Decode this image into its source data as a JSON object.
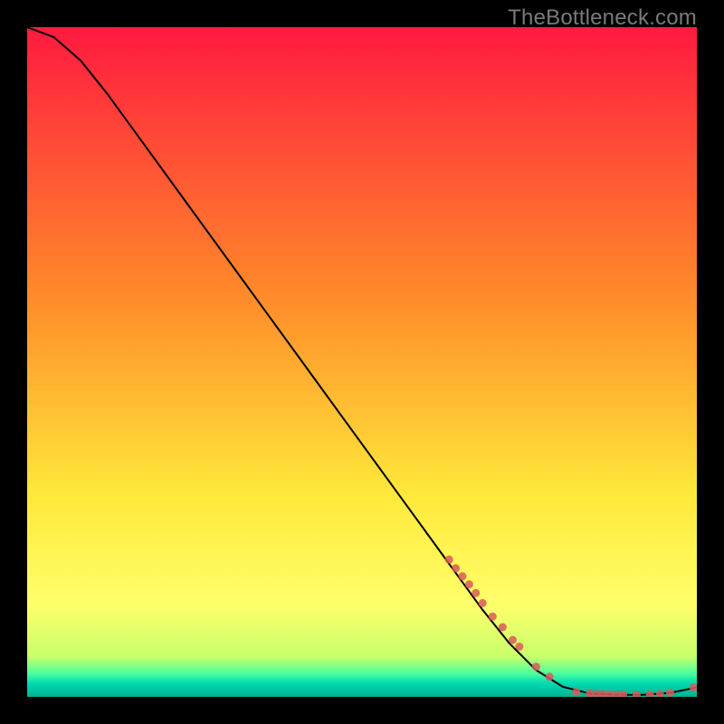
{
  "watermark": "TheBottleneck.com",
  "chart_data": {
    "type": "line",
    "title": "",
    "xlabel": "",
    "ylabel": "",
    "xlim": [
      0,
      100
    ],
    "ylim": [
      0,
      100
    ],
    "grid": false,
    "legend": false,
    "background_gradient": {
      "stops": [
        {
          "offset": 0.0,
          "color": "#ff1a40"
        },
        {
          "offset": 0.4,
          "color": "#ff8a2a"
        },
        {
          "offset": 0.7,
          "color": "#ffe93a"
        },
        {
          "offset": 0.86,
          "color": "#ffff6a"
        },
        {
          "offset": 0.94,
          "color": "#c8ff6a"
        },
        {
          "offset": 0.965,
          "color": "#4cffa0"
        },
        {
          "offset": 0.98,
          "color": "#00d9b2"
        },
        {
          "offset": 1.0,
          "color": "#00b090"
        }
      ]
    },
    "series": [
      {
        "name": "curve",
        "style": "line",
        "color": "#000000",
        "x": [
          0,
          4,
          8,
          12,
          16,
          20,
          24,
          28,
          32,
          36,
          40,
          44,
          48,
          52,
          56,
          60,
          64,
          68,
          72,
          76,
          80,
          84,
          88,
          92,
          96,
          100
        ],
        "y": [
          100,
          98.5,
          95,
          90,
          84.5,
          79,
          73.5,
          68,
          62.5,
          57,
          51.5,
          46,
          40.5,
          35,
          29.5,
          24,
          18.5,
          13,
          8,
          4,
          1.5,
          0.5,
          0.3,
          0.3,
          0.6,
          1.4
        ]
      },
      {
        "name": "markers",
        "style": "markers",
        "color": "#d85a5a",
        "marker_size": 9,
        "x": [
          63,
          64,
          65,
          66,
          67,
          68,
          69.5,
          71,
          72.5,
          73.5,
          76,
          78,
          82,
          84,
          85,
          86,
          87,
          88,
          89,
          91,
          93,
          94.5,
          96,
          99.5
        ],
        "y": [
          20.5,
          19.2,
          18,
          16.8,
          15.5,
          14,
          12,
          10.4,
          8.5,
          7.5,
          4.5,
          3,
          0.7,
          0.5,
          0.45,
          0.4,
          0.35,
          0.33,
          0.32,
          0.3,
          0.32,
          0.4,
          0.6,
          1.4
        ]
      }
    ]
  }
}
